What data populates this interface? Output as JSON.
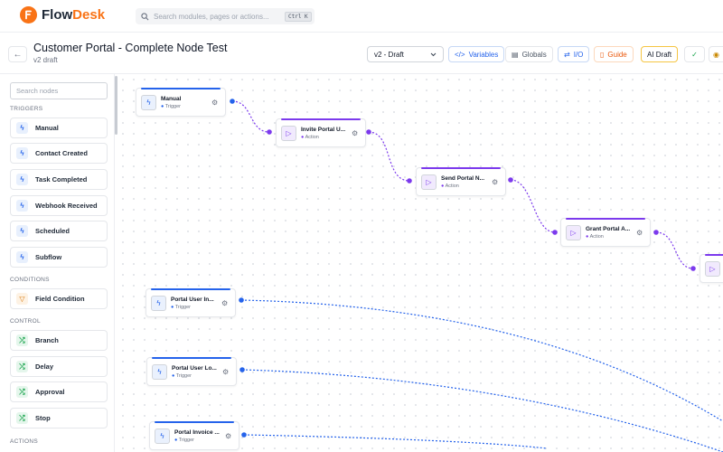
{
  "app": {
    "name_part1": "Flow",
    "name_part2": "Desk",
    "brand_color": "#f97316"
  },
  "search": {
    "placeholder": "Search modules, pages or actions...",
    "shortcut": "Ctrl K"
  },
  "header": {
    "title": "Customer Portal - Complete Node Test",
    "subtitle": "v2 draft",
    "version_select": "v2 - Draft",
    "buttons": {
      "variables": "Variables",
      "globals": "Globals",
      "io": "I/O",
      "guide": "Guide",
      "ai_draft": "AI Draft"
    }
  },
  "sidebar": {
    "search_placeholder": "Search nodes",
    "sections": {
      "triggers": "TRIGGERS",
      "conditions": "CONDITIONS",
      "control": "CONTROL",
      "actions": "ACTIONS"
    },
    "triggers": [
      "Manual",
      "Contact Created",
      "Task Completed",
      "Webhook Received",
      "Scheduled",
      "Subflow"
    ],
    "conditions": [
      "Field Condition"
    ],
    "control": [
      "Branch",
      "Delay",
      "Approval",
      "Stop"
    ]
  },
  "canvas": {
    "nodes": [
      {
        "label": "Manual",
        "type": "Trigger"
      },
      {
        "label": "Invite Portal U...",
        "type": "Action"
      },
      {
        "label": "Send Portal N...",
        "type": "Action"
      },
      {
        "label": "Grant Portal A...",
        "type": "Action"
      },
      {
        "label": "Portal User In...",
        "type": "Trigger"
      },
      {
        "label": "Portal User Lo...",
        "type": "Trigger"
      },
      {
        "label": "Portal Invoice ...",
        "type": "Trigger"
      }
    ]
  },
  "colors": {
    "trigger": "#2563eb",
    "action": "#7c3aed",
    "condition": "#d97706",
    "control": "#16a34a"
  }
}
